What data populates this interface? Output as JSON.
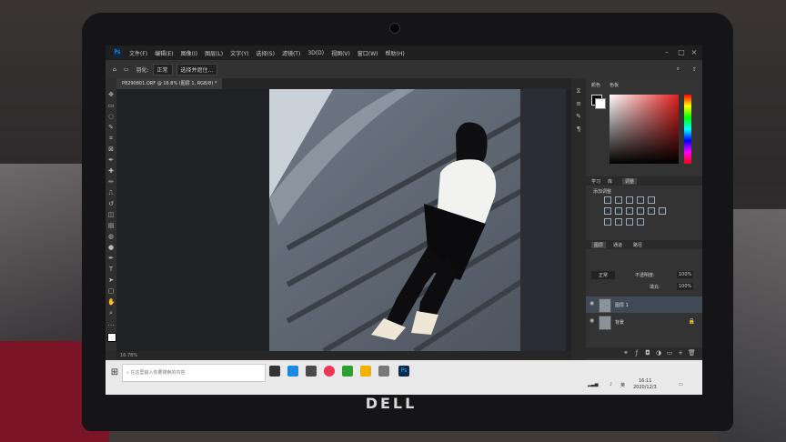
{
  "menubar": {
    "ps_badge": "Ps",
    "items": [
      "文件(F)",
      "编辑(E)",
      "图像(I)",
      "图层(L)",
      "文字(Y)",
      "选择(S)",
      "滤镜(T)",
      "3D(D)",
      "视图(V)",
      "窗口(W)",
      "帮助(H)"
    ]
  },
  "options_bar": {
    "feather_label": "羽化:",
    "style_label": "正常",
    "select_button": "选择并遮住..."
  },
  "document_tab": "P8290801.ORF @ 16.8% (图层 1, RGB/8) *",
  "status_bar": "16.78%",
  "panels": {
    "color_tab": "颜色",
    "swatch_tab": "色板",
    "learn_tab": "学习",
    "library_tab": "库",
    "adjust_tab": "调整",
    "add_adjust_label": "添加调整",
    "layers_tab": "图层",
    "channels_tab": "通道",
    "paths_tab": "路径",
    "blend_mode": "正常",
    "opacity_label": "不透明度:",
    "opacity_value": "100%",
    "fill_label": "填充:",
    "fill_value": "100%"
  },
  "layers": [
    {
      "name": "图层 1"
    },
    {
      "name": "背景"
    }
  ],
  "taskbar": {
    "search_placeholder": "在这里输入你要搜索的内容",
    "time": "16:11",
    "date": "2020/12/3",
    "ime": "英"
  },
  "laptop_brand": "DELL",
  "colors": {
    "ps_dark": "#1f1f1f",
    "ps_panel": "#333333",
    "taskbar": "#e9e9ea",
    "ps_blue": "#31a8ff"
  }
}
